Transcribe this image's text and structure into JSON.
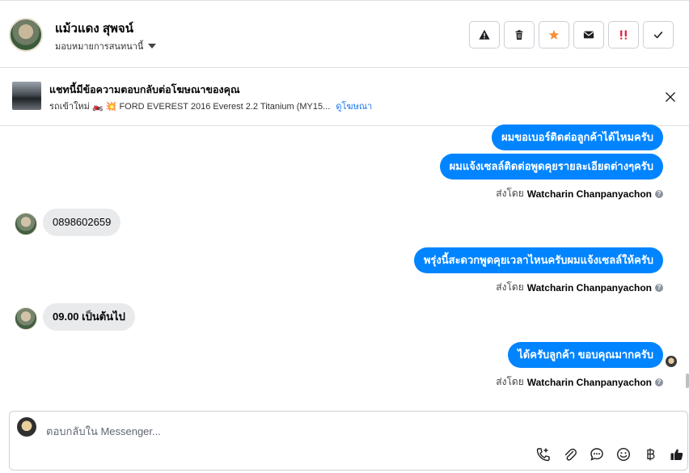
{
  "header": {
    "contact_name": "แม้วแดง สุพจน์",
    "assign_label": "มอบหมายการสนทนานี้"
  },
  "actions": {
    "icons": [
      "warning-icon",
      "trash-icon",
      "star-icon",
      "envelope-icon",
      "double-exclamation-icon",
      "checkmark-icon"
    ],
    "star_color": "#f7923a",
    "alert_color": "#e41e3f"
  },
  "ad": {
    "title": "แชทนี้มีข้อความตอบกลับต่อโฆษณาของคุณ",
    "subtitle": "รถเข้าใหม่ 🏍️ 💥 FORD EVEREST 2016 Everest 2.2 Titanium (MY15...",
    "link": "ดูโฆษณา"
  },
  "thread": {
    "messages": [
      {
        "from": "page",
        "text": "ผมขอเบอร์ติดต่อลูกค้าได้ไหมครับ"
      },
      {
        "from": "page",
        "text": "ผมแจ้งเซลล์ติดต่อพูดคุยรายละเอียดต่างๆครับ"
      },
      {
        "from": "customer",
        "text": "0898602659"
      },
      {
        "from": "page",
        "text": "พรุ่งนี้สะดวกพูดคุยเวลาไหนครับผมแจ้งเซลล์ให้ครับ"
      },
      {
        "from": "customer",
        "text": "09.00 เป็นต้นไป"
      },
      {
        "from": "page",
        "text": "ได้ครับลูกค้า ขอบคุณมากครับ"
      }
    ],
    "sent_by_prefix": "ส่งโดย",
    "sender_name": "Watcharin Chanpanyachon",
    "bubble_color": "#0084ff",
    "incoming_color": "#e9eaec"
  },
  "composer": {
    "placeholder": "ตอบกลับใน Messenger...",
    "tools": [
      "phone-plus-icon",
      "paperclip-icon",
      "chat-bubble-icon",
      "emoji-icon",
      "baht-icon",
      "thumbs-up-icon"
    ]
  }
}
